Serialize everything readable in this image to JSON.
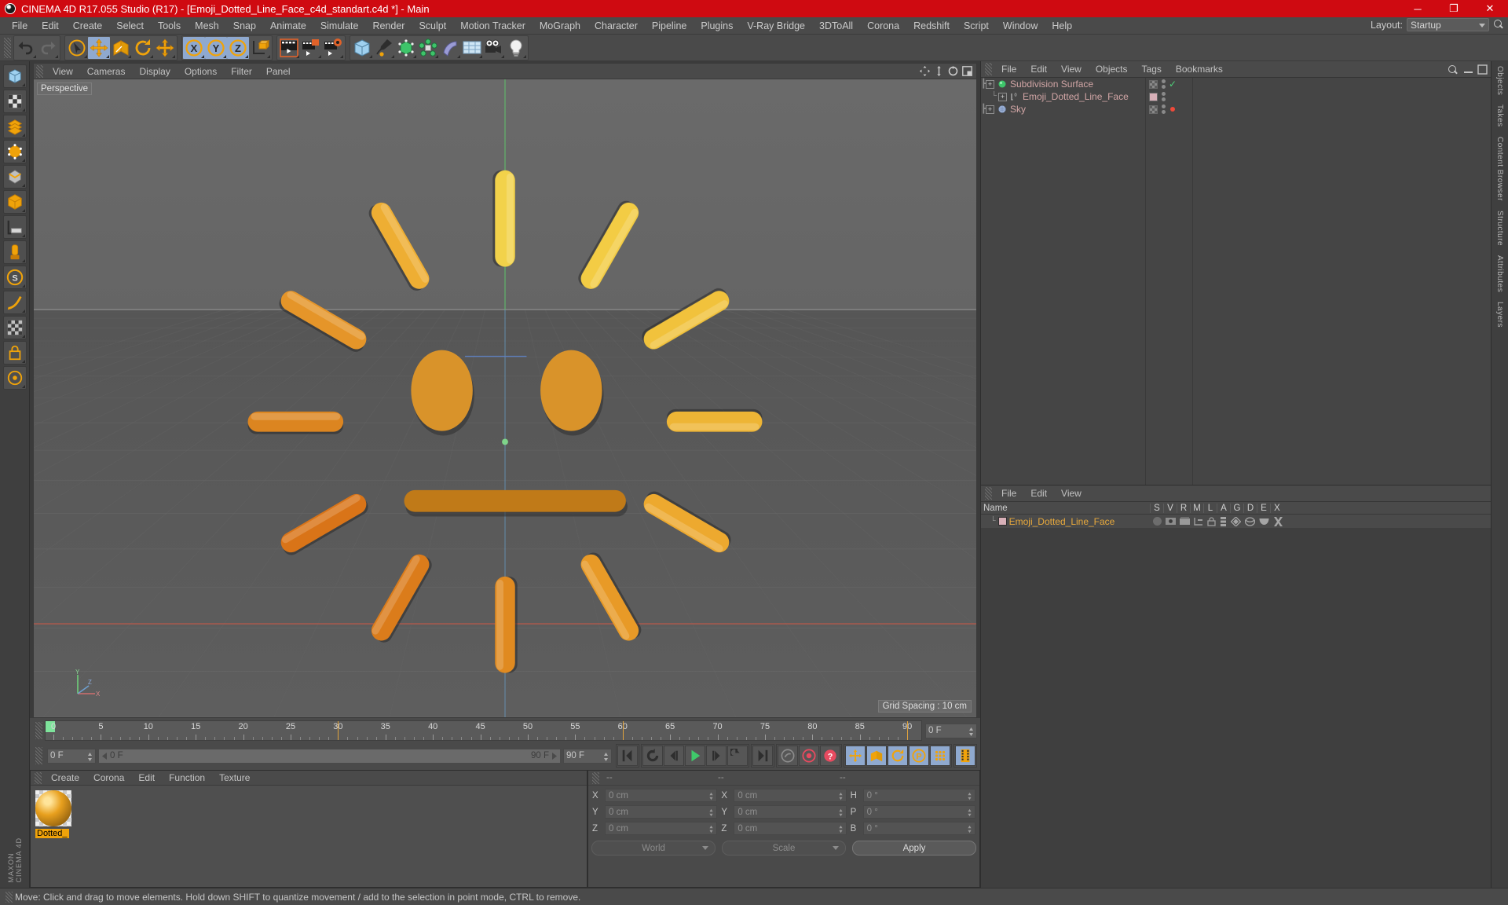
{
  "window": {
    "title": "CINEMA 4D R17.055 Studio (R17) - [Emoji_Dotted_Line_Face_c4d_standart.c4d *] - Main",
    "minimize": "─",
    "maximize": "❐",
    "close": "✕"
  },
  "menubar": {
    "items": [
      {
        "label": "File"
      },
      {
        "label": "Edit"
      },
      {
        "label": "Create"
      },
      {
        "label": "Select"
      },
      {
        "label": "Tools"
      },
      {
        "label": "Mesh"
      },
      {
        "label": "Snap"
      },
      {
        "label": "Animate"
      },
      {
        "label": "Simulate"
      },
      {
        "label": "Render"
      },
      {
        "label": "Sculpt"
      },
      {
        "label": "Motion Tracker"
      },
      {
        "label": "MoGraph"
      },
      {
        "label": "Character"
      },
      {
        "label": "Pipeline"
      },
      {
        "label": "Plugins"
      },
      {
        "label": "V-Ray Bridge"
      },
      {
        "label": "3DToAll"
      },
      {
        "label": "Corona"
      },
      {
        "label": "Redshift"
      },
      {
        "label": "Script"
      },
      {
        "label": "Window"
      },
      {
        "label": "Help"
      }
    ],
    "layout_label": "Layout:",
    "layout_value": "Startup"
  },
  "toolbar": {
    "groups": [
      {
        "name": "history",
        "buttons": [
          {
            "name": "undo-button",
            "icon": "undo-icon",
            "active": false
          },
          {
            "name": "redo-button",
            "icon": "redo-icon",
            "active": false
          }
        ]
      },
      {
        "name": "transform",
        "buttons": [
          {
            "name": "select-tool-button",
            "icon": "live-selection-icon",
            "active": false
          },
          {
            "name": "move-tool-button",
            "icon": "move-icon",
            "active": true
          },
          {
            "name": "scale-tool-button",
            "icon": "scale-icon",
            "active": false
          },
          {
            "name": "rotate-tool-button",
            "icon": "rotate-icon",
            "active": false
          },
          {
            "name": "dynamic-place-button",
            "icon": "move-icon",
            "active": false
          }
        ]
      },
      {
        "name": "axis-lock",
        "buttons": [
          {
            "name": "axis-x-button",
            "icon": "x-axis-icon",
            "active": true
          },
          {
            "name": "axis-y-button",
            "icon": "y-axis-icon",
            "active": true
          },
          {
            "name": "axis-z-button",
            "icon": "z-axis-icon",
            "active": true
          },
          {
            "name": "world-coordinates-button",
            "icon": "world-axis-icon",
            "active": false
          }
        ]
      },
      {
        "name": "render",
        "buttons": [
          {
            "name": "render-view-button",
            "icon": "render-view-icon",
            "active": false
          },
          {
            "name": "render-region-button",
            "icon": "render-region-icon",
            "active": false
          },
          {
            "name": "render-settings-button",
            "icon": "render-settings-icon",
            "active": false
          }
        ]
      },
      {
        "name": "create",
        "buttons": [
          {
            "name": "cube-primitive-button",
            "icon": "cube-icon",
            "active": false
          },
          {
            "name": "spline-pen-button",
            "icon": "pen-icon",
            "active": false
          },
          {
            "name": "nurbs-generator-button",
            "icon": "subdivision-surface-icon",
            "active": false
          },
          {
            "name": "array-button",
            "icon": "array-icon",
            "active": false
          },
          {
            "name": "bend-deformer-button",
            "icon": "bend-icon",
            "active": false
          },
          {
            "name": "floor-environment-button",
            "icon": "floor-icon",
            "active": false
          },
          {
            "name": "camera-button",
            "icon": "camera-icon",
            "active": false
          },
          {
            "name": "light-button",
            "icon": "light-icon",
            "active": false
          }
        ]
      }
    ]
  },
  "leftrail": {
    "buttons": [
      {
        "name": "model-mode-button",
        "icon": "model-mode-icon"
      },
      {
        "name": "texture-mode-button",
        "icon": "texture-mode-icon"
      },
      {
        "name": "polygon-mode-button",
        "icon": "polygon-mode-icon"
      },
      {
        "name": "point-mode-button",
        "icon": "point-mode-icon"
      },
      {
        "name": "edge-mode-button",
        "icon": "edge-mode-icon"
      },
      {
        "name": "object-mode-button",
        "icon": "object-mode-icon"
      },
      {
        "name": "workplane-button",
        "icon": "workplane-icon"
      },
      {
        "name": "enable-axis-button",
        "icon": "axis-modification-icon"
      },
      {
        "name": "snap-settings-button",
        "icon": "snap-icon"
      },
      {
        "name": "selection-filter-button",
        "icon": "filter-icon"
      },
      {
        "name": "viewport-solo-button",
        "icon": "solo-icon"
      },
      {
        "name": "lock-button",
        "icon": "lock-icon"
      },
      {
        "name": "world-origin-button",
        "icon": "origin-icon"
      }
    ],
    "brand_top": "MAXON",
    "brand_bottom": "CINEMA 4D"
  },
  "viewport": {
    "menu": [
      {
        "label": "View"
      },
      {
        "label": "Cameras"
      },
      {
        "label": "Display"
      },
      {
        "label": "Options"
      },
      {
        "label": "Filter"
      },
      {
        "label": "Panel"
      }
    ],
    "view_label": "Perspective",
    "grid_spacing": "Grid Spacing : 10 cm",
    "axis_labels": {
      "y": "Y",
      "x": "X",
      "z": "Z"
    },
    "icons": [
      {
        "name": "viewport-move-icon"
      },
      {
        "name": "viewport-scale-icon"
      },
      {
        "name": "viewport-rotate-icon"
      },
      {
        "name": "viewport-maximize-icon"
      }
    ],
    "scene": {
      "mouth_color": "#c07a18",
      "eye_color": "#d9932a",
      "dash_colors": [
        "#f2d24a",
        "#f3cc44",
        "#f1c23c",
        "#eeb535",
        "#eda92f",
        "#e89a27",
        "#e08a20",
        "#db7c1b",
        "#d97418",
        "#dc8520",
        "#e59529",
        "#eeae33"
      ]
    }
  },
  "timeline": {
    "ticks": [
      0,
      5,
      10,
      15,
      20,
      25,
      30,
      35,
      40,
      45,
      50,
      55,
      60,
      65,
      70,
      75,
      80,
      85,
      90
    ],
    "current_frame": "0 F",
    "range_start": "0 F",
    "range_end": "90 F",
    "end_frame": "90 F",
    "preview_frame": "0 F",
    "transport": [
      {
        "name": "goto-start-button",
        "icon": "skip-start-icon"
      },
      {
        "name": "play-backward-loop-button",
        "icon": "loop-back-icon"
      },
      {
        "name": "step-back-button",
        "icon": "step-back-icon"
      },
      {
        "name": "play-button",
        "icon": "play-icon"
      },
      {
        "name": "step-forward-button",
        "icon": "step-forward-icon"
      },
      {
        "name": "play-forward-loop-button",
        "icon": "loop-forward-icon"
      },
      {
        "name": "goto-end-button",
        "icon": "skip-end-icon"
      }
    ],
    "record_tools": [
      {
        "name": "autokey-button",
        "icon": "autokey-icon"
      },
      {
        "name": "record-active-objects-button",
        "icon": "record-icon"
      },
      {
        "name": "keyframe-selection-button",
        "icon": "keyframe-selection-icon"
      }
    ],
    "key_toggles": [
      {
        "name": "position-key-button",
        "icon": "position-key-icon"
      },
      {
        "name": "scale-key-button",
        "icon": "scale-key-icon"
      },
      {
        "name": "rotation-key-button",
        "icon": "rotation-key-icon"
      },
      {
        "name": "parameter-key-button",
        "icon": "parameter-key-icon"
      },
      {
        "name": "pla-key-button",
        "icon": "point-level-animation-icon"
      }
    ],
    "filmstrip": {
      "name": "timeline-filmstrip-button",
      "icon": "filmstrip-icon"
    }
  },
  "material_manager": {
    "menu": [
      {
        "label": "Create"
      },
      {
        "label": "Corona"
      },
      {
        "label": "Edit"
      },
      {
        "label": "Function"
      },
      {
        "label": "Texture"
      }
    ],
    "materials": [
      {
        "name": "Dotted_",
        "selected": true
      }
    ]
  },
  "coordinate_manager": {
    "header": [
      "--",
      "--",
      "--"
    ],
    "rows": [
      {
        "axis1": "X",
        "value1": "0 cm",
        "axis2": "X",
        "value2": "0 cm",
        "axis3": "H",
        "value3": "0 °"
      },
      {
        "axis1": "Y",
        "value1": "0 cm",
        "axis2": "Y",
        "value2": "0 cm",
        "axis3": "P",
        "value3": "0 °"
      },
      {
        "axis1": "Z",
        "value1": "0 cm",
        "axis2": "Z",
        "value2": "0 cm",
        "axis3": "B",
        "value3": "0 °"
      }
    ],
    "system": "World",
    "mode": "Scale",
    "apply": "Apply"
  },
  "object_manager": {
    "menu": [
      {
        "label": "File"
      },
      {
        "label": "Edit"
      },
      {
        "label": "View"
      },
      {
        "label": "Objects"
      },
      {
        "label": "Tags"
      },
      {
        "label": "Bookmarks"
      }
    ],
    "objects": [
      {
        "name": "Subdivision Surface",
        "icon": "subdivision-surface-icon",
        "depth": 0,
        "tag": "checker",
        "enabled": "check",
        "selected": false
      },
      {
        "name": "Emoji_Dotted_Line_Face",
        "icon": "polygon-object-icon",
        "depth": 1,
        "tag": "material",
        "enabled": "none",
        "selected": false
      },
      {
        "name": "Sky",
        "icon": "sky-icon",
        "depth": 0,
        "tag": "checker",
        "enabled": "dot",
        "selected": false
      }
    ]
  },
  "attribute_manager": {
    "menu": [
      {
        "label": "File"
      },
      {
        "label": "Edit"
      },
      {
        "label": "View"
      }
    ],
    "columns": [
      "Name",
      "S",
      "V",
      "R",
      "M",
      "L",
      "A",
      "G",
      "D",
      "E",
      "X"
    ],
    "rows": [
      {
        "name": "Emoji_Dotted_Line_Face",
        "selected": true
      }
    ]
  },
  "right_rail": {
    "tabs": [
      "Objects",
      "Takes",
      "Content Browser",
      "Structure",
      "Attributes",
      "Layers"
    ]
  },
  "statusbar": {
    "message": "Move: Click and drag to move elements. Hold down SHIFT to quantize movement / add to the selection in point mode, CTRL to remove."
  },
  "colors": {
    "title_bar": "#cf0a11",
    "panel": "#4a4a4a",
    "viewport_top": "#666666",
    "viewport_bottom": "#5a5a5a",
    "accent_orange": "#f0a30a",
    "selection_blue": "#8fa9cf"
  }
}
